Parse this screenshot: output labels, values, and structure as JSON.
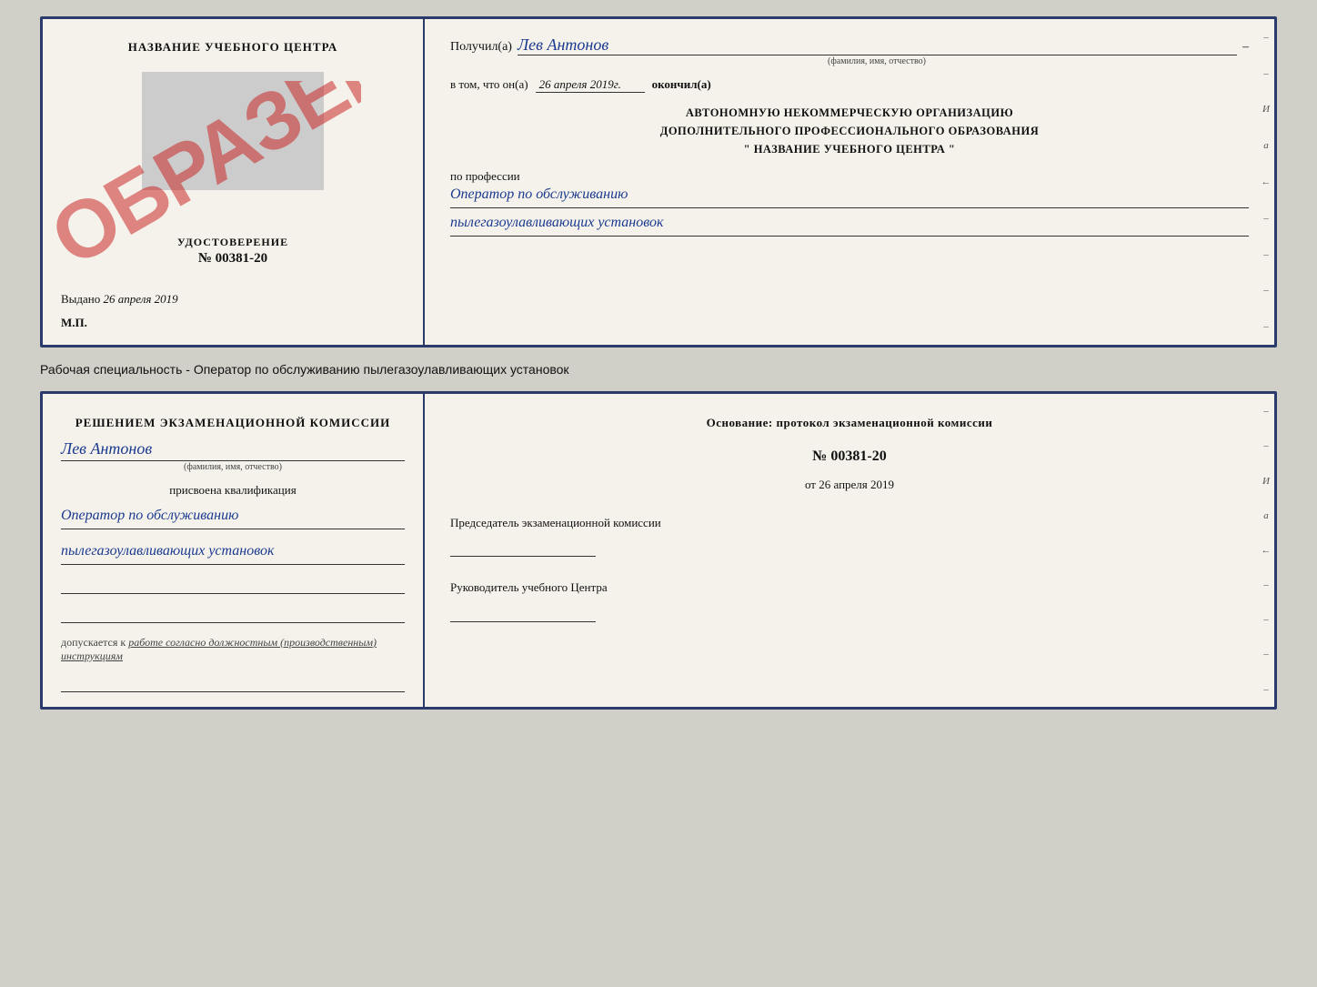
{
  "top_left": {
    "school_name": "НАЗВАНИЕ УЧЕБНОГО ЦЕНТРА",
    "udostoverenie_label": "УДОСТОВЕРЕНИЕ",
    "number": "№ 00381-20",
    "vydano_label": "Выдано",
    "vydano_date": "26 апреля 2019",
    "mp_label": "М.П.",
    "obrazec": "ОБРАЗЕЦ"
  },
  "top_right": {
    "poluchil_label": "Получил(а)",
    "recipient_name": "Лев Антонов",
    "fio_hint": "(фамилия, имя, отчество)",
    "dash": "–",
    "vtom_label": "в том, что он(а)",
    "vtom_date": "26 апреля 2019г.",
    "okonchil_label": "окончил(а)",
    "org_line1": "АВТОНОМНУЮ НЕКОММЕРЧЕСКУЮ ОРГАНИЗАЦИЮ",
    "org_line2": "ДОПОЛНИТЕЛЬНОГО ПРОФЕССИОНАЛЬНОГО ОБРАЗОВАНИЯ",
    "org_line3": "\"   НАЗВАНИЕ УЧЕБНОГО ЦЕНТРА   \"",
    "po_professii": "по профессии",
    "profession_line1": "Оператор по обслуживанию",
    "profession_line2": "пылегазоулавливающих установок"
  },
  "middle_label": "Рабочая специальность - Оператор по обслуживанию пылегазоулавливающих установок",
  "bottom_left": {
    "resheniem_text": "Решением экзаменационной комиссии",
    "name": "Лев Антонов",
    "fio_hint": "(фамилия, имя, отчество)",
    "prisvoena_label": "присвоена квалификация",
    "qual_line1": "Оператор по обслуживанию",
    "qual_line2": "пылегазоулавливающих установок",
    "dopuskaetsya_prefix": "допускается к",
    "dopuskaetsya_italic": "работе согласно должностным (производственным) инструкциям"
  },
  "bottom_right": {
    "osnovanie_text": "Основание: протокол экзаменационной комиссии",
    "protocol_number": "№  00381-20",
    "ot_label": "от",
    "ot_date": "26 апреля 2019",
    "predsedatel_label": "Председатель экзаменационной комиссии",
    "rukovoditel_label": "Руководитель учебного Центра"
  },
  "right_indicators": [
    "И",
    "а",
    "←",
    "–",
    "–",
    "–",
    "–",
    "–"
  ],
  "binding_dots_count": 8
}
